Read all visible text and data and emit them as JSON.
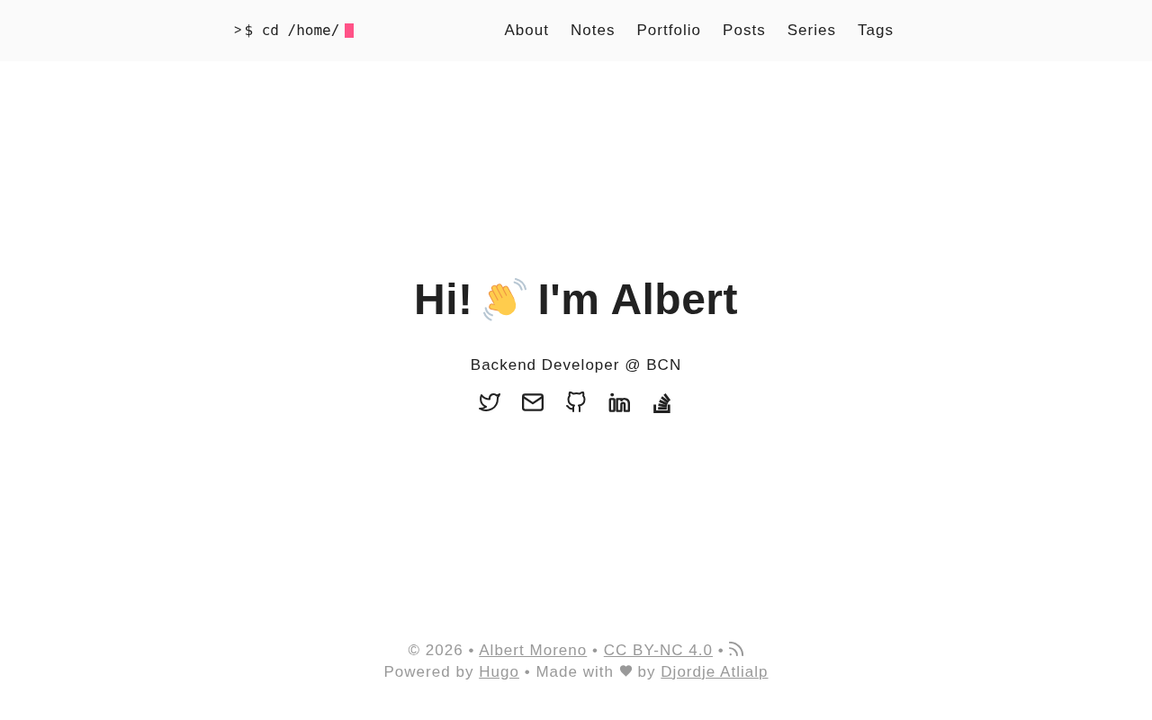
{
  "header": {
    "logo": {
      "prompt": ">",
      "command": "$ cd /home/"
    },
    "nav": [
      {
        "label": "About"
      },
      {
        "label": "Notes"
      },
      {
        "label": "Portfolio"
      },
      {
        "label": "Posts"
      },
      {
        "label": "Series"
      },
      {
        "label": "Tags"
      }
    ]
  },
  "hero": {
    "greeting": "Hi!",
    "name": "I'm Albert",
    "subtitle": "Backend Developer @ BCN",
    "social_links": [
      {
        "kind": "twitter"
      },
      {
        "kind": "email"
      },
      {
        "kind": "github"
      },
      {
        "kind": "linkedin"
      },
      {
        "kind": "stackoverflow"
      }
    ]
  },
  "footer": {
    "lines": [
      [
        {
          "kind": "text",
          "text": "© 2026 •"
        },
        {
          "kind": "link",
          "text": "Albert Moreno"
        },
        {
          "kind": "text",
          "text": "•"
        },
        {
          "kind": "link",
          "text": "CC BY-NC 4.0"
        },
        {
          "kind": "text",
          "text": "•"
        },
        {
          "kind": "feed"
        }
      ],
      [
        {
          "kind": "text",
          "text": "Powered by"
        },
        {
          "kind": "link",
          "text": "Hugo"
        },
        {
          "kind": "text",
          "text": "• Made with"
        },
        {
          "kind": "heart"
        },
        {
          "kind": "text",
          "text": "by"
        },
        {
          "kind": "link",
          "text": "Djordje Atlialp"
        }
      ]
    ]
  }
}
